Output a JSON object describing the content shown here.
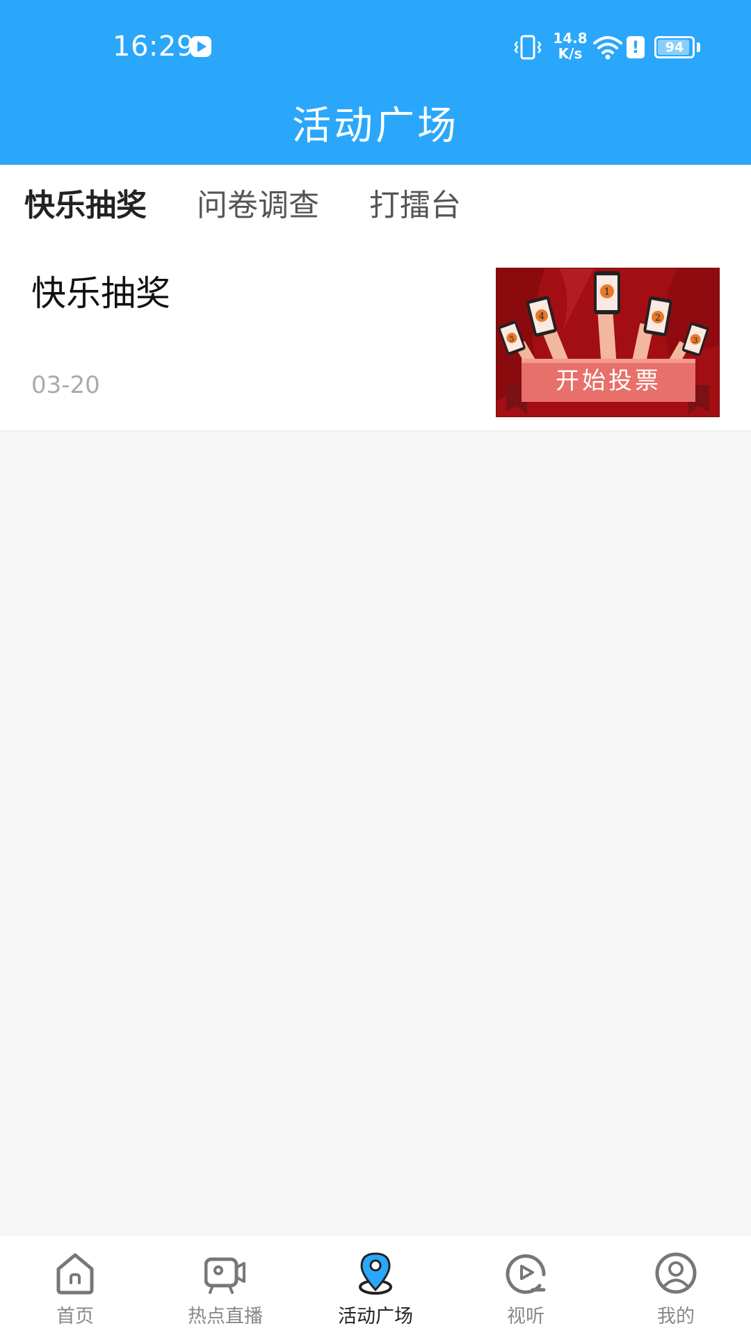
{
  "status_bar": {
    "time": "16:29",
    "net_speed_value": "14.8",
    "net_speed_unit": "K/s",
    "battery": "94",
    "battery_level": 0.94,
    "icons": [
      "app-notification-icon",
      "vibrate-icon",
      "wifi-icon",
      "alert-icon",
      "battery-icon"
    ]
  },
  "header": {
    "title": "活动广场"
  },
  "tabs": [
    {
      "label": "快乐抽奖",
      "active": true
    },
    {
      "label": "问卷调查",
      "active": false
    },
    {
      "label": "打擂台",
      "active": false
    }
  ],
  "items": [
    {
      "title": "快乐抽奖",
      "date": "03-20",
      "thumbnail": {
        "caption": "开始投票",
        "badges": [
          "1",
          "2",
          "3",
          "4",
          "5"
        ]
      }
    }
  ],
  "bottom_nav": [
    {
      "label": "首页",
      "icon": "home-icon",
      "active": false
    },
    {
      "label": "热点直播",
      "icon": "live-camera-icon",
      "active": false
    },
    {
      "label": "活动广场",
      "icon": "location-pin-icon",
      "active": true
    },
    {
      "label": "视听",
      "icon": "play-circle-icon",
      "active": false
    },
    {
      "label": "我的",
      "icon": "user-profile-icon",
      "active": false
    }
  ],
  "colors": {
    "primary": "#2aa7fb",
    "nav_inactive": "#888888",
    "nav_active": "#222222",
    "date_text": "#aaaaaa",
    "thumbnail_bg": "#a30e12"
  }
}
